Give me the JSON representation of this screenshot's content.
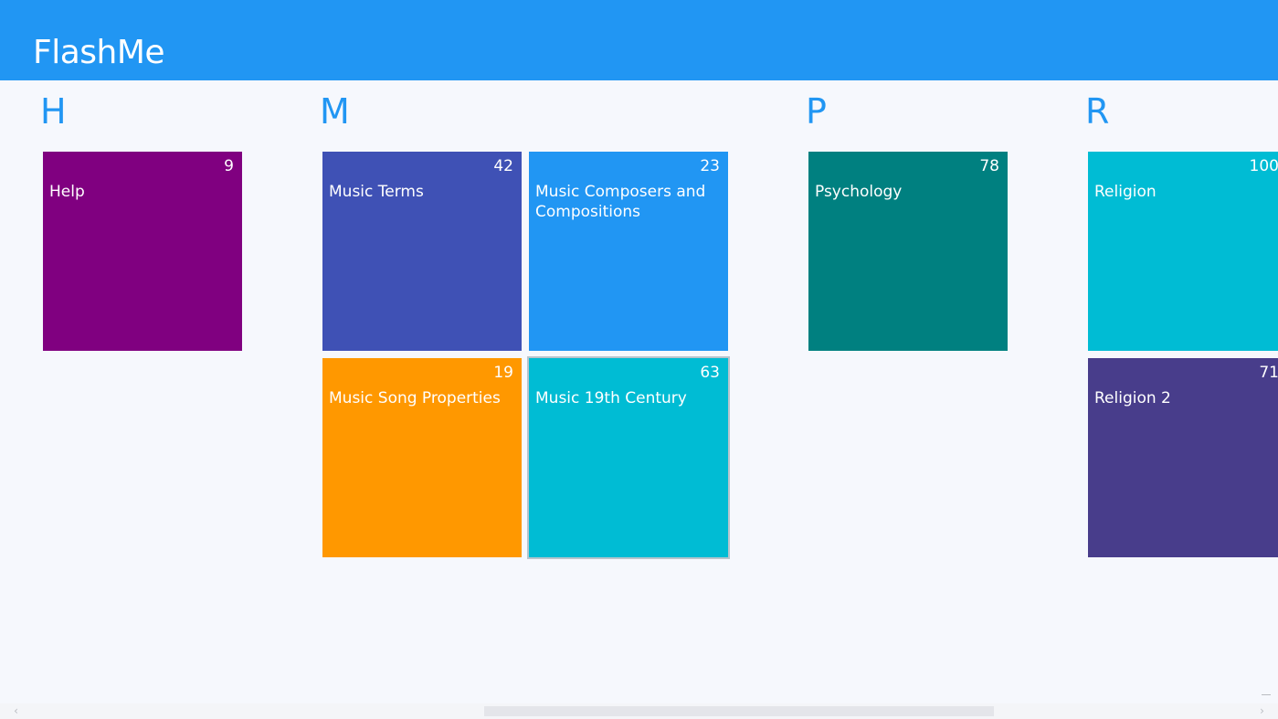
{
  "app": {
    "title": "FlashMe",
    "accent_color": "#2196f3",
    "background_color": "#f6f8fd"
  },
  "groups": [
    {
      "letter": "H",
      "tiles": [
        {
          "label": "Help",
          "count": "9",
          "color": "#800080"
        }
      ]
    },
    {
      "letter": "M",
      "tiles": [
        {
          "label": "Music Terms",
          "count": "42",
          "color": "#3f51b5"
        },
        {
          "label": "Music Composers and Compositions",
          "count": "23",
          "color": "#2196f3"
        },
        {
          "label": "Music Song Properties",
          "count": "19",
          "color": "#ff9800"
        },
        {
          "label": "Music 19th Century",
          "count": "63",
          "color": "#00bcd4",
          "selected": true
        }
      ]
    },
    {
      "letter": "P",
      "tiles": [
        {
          "label": "Psychology",
          "count": "78",
          "color": "#008080"
        }
      ]
    },
    {
      "letter": "R",
      "tiles": [
        {
          "label": "Religion",
          "count": "100",
          "color": "#00bcd4"
        },
        {
          "label": "Religion 2",
          "count": "71",
          "color": "#483d8b"
        }
      ]
    }
  ],
  "scrollbar": {
    "left_arrow_icon": "chevron-left-icon",
    "right_arrow_icon": "chevron-right-icon",
    "left_arrow_glyph": "‹",
    "right_arrow_glyph": "›"
  }
}
